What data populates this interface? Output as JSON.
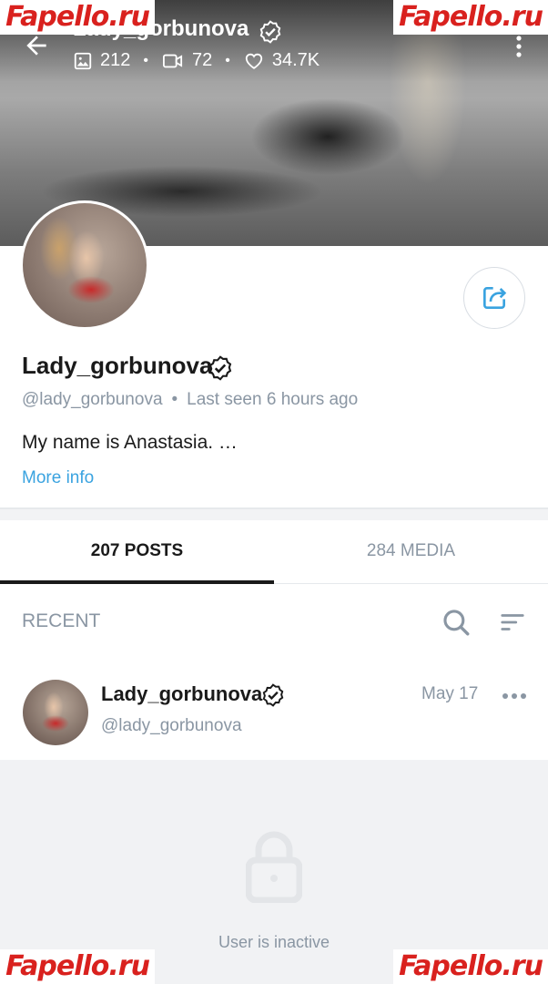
{
  "watermark": "Fapello.ru",
  "header": {
    "title": "Lady_gorbunova",
    "stats": {
      "photos": "212",
      "videos": "72",
      "likes": "34.7K"
    },
    "separator": "•"
  },
  "profile": {
    "name": "Lady_gorbunova",
    "handle": "@lady_gorbunova",
    "meta_separator": "•",
    "last_seen": "Last seen 6 hours ago",
    "bio": "My name is Anastasia. …",
    "more_info": "More info"
  },
  "tabs": [
    {
      "label": "207 POSTS",
      "active": true
    },
    {
      "label": "284 MEDIA",
      "active": false
    }
  ],
  "feed": {
    "section_label": "RECENT",
    "post": {
      "name": "Lady_gorbunova",
      "handle": "@lady_gorbunova",
      "date": "May 17",
      "status": "User is inactive"
    }
  },
  "colors": {
    "accent": "#3aa3e0",
    "muted": "#8a96a3",
    "text": "#1a1a1a",
    "watermark": "#d9211e"
  }
}
